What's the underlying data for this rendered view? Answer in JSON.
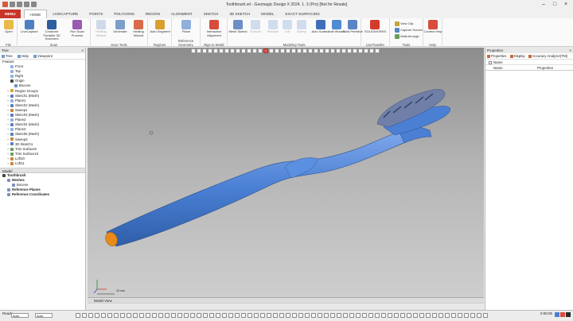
{
  "window": {
    "title": "Toothbrush.xrl - Geomagic Design X 2024. 1. 3 (Pro) [Not for Resale]"
  },
  "tabs": [
    "MENU",
    "HOME",
    "LIVECAPTURE",
    "POINTS",
    "POLYGONS",
    "REGION",
    "ALIGNMENT",
    "SKETCH",
    "3D SKETCH",
    "MODEL",
    "EXACT SURFACING"
  ],
  "ribbon": {
    "groups": {
      "file": "File",
      "scan": "Scan",
      "scan_tools": "Scan Tools",
      "regions": "Regions",
      "reference_geometry": "Reference Geometry",
      "align_to_world": "Align to World",
      "modeling_tools": "Modeling Tools",
      "livetransfer": "LiveTransfer",
      "tools": "Tools",
      "help": "Help"
    },
    "buttons": {
      "open": "Open",
      "livecapture": "LiveCapture",
      "creaform": "Creaform Portable 3D Scanners",
      "run_scan": "Run Scan Process",
      "healing": "Healing Wizard",
      "decimate": "Decimate",
      "wizard": "Healing Wizard",
      "auto_segment": "Auto Segment",
      "plane": "Plane",
      "interactive_alignment": "Interactive Alignment",
      "mesh_sketch": "Mesh Sketch",
      "extrude": "Extrude",
      "revolve": "Revolve",
      "loft": "Loft",
      "sweep": "Sweep",
      "auto_surface": "Auto Surface",
      "loft_wizard": "Loft Wizard",
      "solid_primitive": "Solid Primitive",
      "solidworks": "SOLIDWORKS",
      "view_clip": "View Clip",
      "capture_screen": "Capture Screen",
      "walk_through": "Walk-through",
      "context_help": "Context Help"
    }
  },
  "tree_pane": {
    "title": "Tree",
    "tabs": [
      "Tree",
      "Help",
      "Viewpoint"
    ],
    "feature_label": "Feature",
    "items": [
      {
        "label": "Front",
        "depth": 1,
        "icon": "plane"
      },
      {
        "label": "Top",
        "depth": 1,
        "icon": "plane"
      },
      {
        "label": "Right",
        "depth": 1,
        "icon": "plane"
      },
      {
        "label": "Origin",
        "depth": 1,
        "icon": "origin"
      },
      {
        "label": "Bocene",
        "depth": 2,
        "icon": "mesh"
      },
      {
        "label": "Region Group1",
        "depth": 1,
        "icon": "region"
      },
      {
        "label": "Sketch1 (Mesh)",
        "depth": 1,
        "icon": "sketch"
      },
      {
        "label": "Plane1",
        "depth": 1,
        "icon": "plane"
      },
      {
        "label": "Sketch2 (Mesh)",
        "depth": 1,
        "icon": "sketch"
      },
      {
        "label": "Sweep1",
        "depth": 1,
        "icon": "solid"
      },
      {
        "label": "Sketch3 (Mesh)",
        "depth": 1,
        "icon": "sketch"
      },
      {
        "label": "Plane2",
        "depth": 1,
        "icon": "plane"
      },
      {
        "label": "Sketch4 (Mesh)",
        "depth": 1,
        "icon": "sketch"
      },
      {
        "label": "Plane3",
        "depth": 1,
        "icon": "plane"
      },
      {
        "label": "Sketch5 (Mesh)",
        "depth": 1,
        "icon": "sketch"
      },
      {
        "label": "Sweep3",
        "depth": 1,
        "icon": "solid"
      },
      {
        "label": "3D Sketch1",
        "depth": 1,
        "icon": "sketch"
      },
      {
        "label": "Trim Surface9",
        "depth": 1,
        "icon": "surface"
      },
      {
        "label": "Trim Surface10",
        "depth": 1,
        "icon": "surface"
      },
      {
        "label": "Loft10",
        "depth": 1,
        "icon": "solid"
      },
      {
        "label": "Loft11",
        "depth": 1,
        "icon": "solid"
      }
    ],
    "model_label": "Model",
    "model_items": [
      {
        "label": "Toothbrush",
        "bold": true,
        "depth": 0
      },
      {
        "label": "Meshes",
        "bold": true,
        "depth": 1
      },
      {
        "label": "Bocene",
        "bold": false,
        "depth": 2
      },
      {
        "label": "Reference Planes",
        "bold": true,
        "depth": 1
      },
      {
        "label": "Reference Coordinates",
        "bold": true,
        "depth": 1
      }
    ]
  },
  "viewport": {
    "label": "Model View",
    "scale_text": "15 mm"
  },
  "properties_pane": {
    "title": "Properties",
    "tabs": [
      "Properties",
      "Display",
      "Accuracy Analyzer(TM)"
    ],
    "name_label": "Name",
    "columns": [
      "Name",
      "Properties"
    ]
  },
  "status": {
    "text": "Ready",
    "dropdown1": "Auto",
    "dropdown2": "Auto",
    "time": "0:00:05"
  },
  "colors": {
    "accent": "#c8342a",
    "model_blue": "#4a7fd4",
    "model_orange": "#e88a1a"
  }
}
